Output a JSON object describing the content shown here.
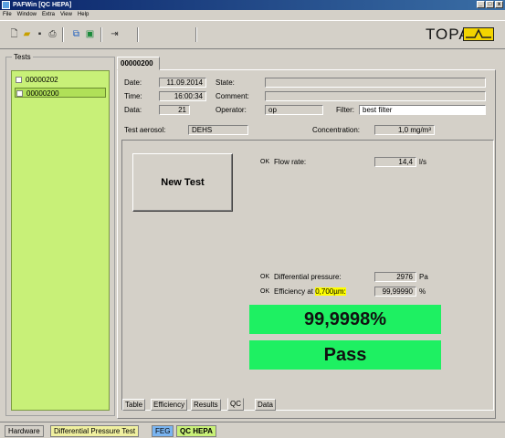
{
  "window": {
    "title": "PAFWin   [QC HEPA]",
    "min": "_",
    "max": "□",
    "close": "x"
  },
  "menu": [
    "File",
    "Window",
    "Extra",
    "View",
    "Help"
  ],
  "brand": {
    "name": "TOPAS",
    "logo_color": "#f3d400"
  },
  "tests": {
    "label": "Tests",
    "items": [
      "00000202",
      "00000200"
    ],
    "selected_index": 1
  },
  "tab": {
    "label": "00000200"
  },
  "info": {
    "date_label": "Date:",
    "date": "11.09.2014",
    "time_label": "Time:",
    "time": "16:00:34",
    "data_label": "Data:",
    "data": "21",
    "state_label": "State:",
    "state": "",
    "comment_label": "Comment:",
    "comment": "",
    "operator_label": "Operator:",
    "operator": "op",
    "filter_label": "Filter:",
    "filter": "best filter",
    "aerosol_label": "Test aerosol:",
    "aerosol": "DEHS",
    "concentration_label": "Concentration:",
    "concentration": "1,0 mg/m³"
  },
  "qc": {
    "new_test": "New Test",
    "flow": {
      "ok": "OK",
      "label": "Flow rate:",
      "value": "14,4",
      "unit": "l/s"
    },
    "dp": {
      "ok": "OK",
      "label": "Differential pressure:",
      "value": "2976",
      "unit": "Pa"
    },
    "eff": {
      "ok": "OK",
      "label_pre": "Efficiency at ",
      "label_hl": "0,700µm:",
      "value": "99,99990",
      "unit": "%"
    },
    "big_value": "99,9998%",
    "result": "Pass",
    "result_color": "#1ef062"
  },
  "subtabs": [
    "Table",
    "Efficiency",
    "Results",
    "QC",
    "Data"
  ],
  "active_subtab": "QC",
  "taskbar": [
    {
      "label": "Hardware",
      "color": "#d4d0c8"
    },
    {
      "label": "Differential Pressure Test",
      "color": "#f0f0a0"
    },
    {
      "label": "FEG",
      "color": "#7ab4f0"
    },
    {
      "label": "QC HEPA",
      "color": "#c8f078"
    }
  ]
}
